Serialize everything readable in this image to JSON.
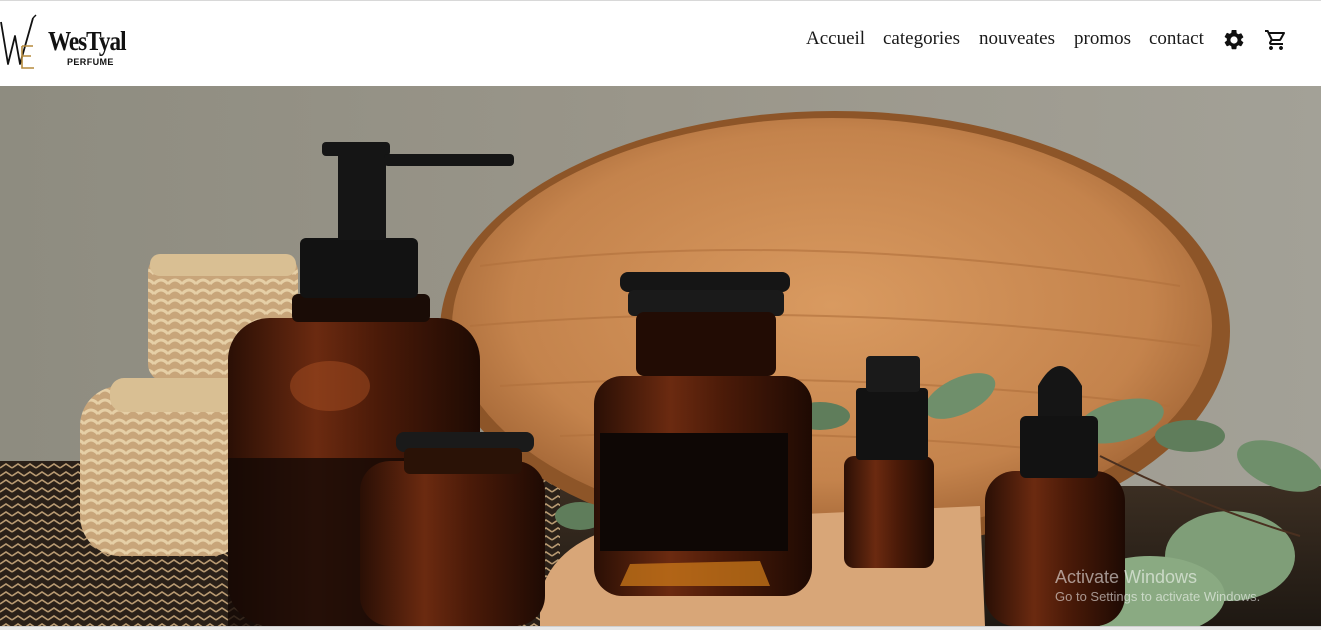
{
  "brand": {
    "name": "WesTyal",
    "tagline": "PERFUME",
    "monogram_icon": "we-monogram-logo",
    "gold": "#b58a3c"
  },
  "nav": {
    "items": [
      {
        "label": "Accueil"
      },
      {
        "label": "categories"
      },
      {
        "label": "nouveates"
      },
      {
        "label": "promos"
      },
      {
        "label": "contact"
      }
    ],
    "settings_icon": "gear-icon",
    "cart_icon": "shopping-cart-icon"
  },
  "hero": {
    "subject": "amber-glass-bottles-wooden-tray",
    "colors": {
      "wall": "#8f8f86",
      "wood": "#c98a52",
      "amber": "#4a1d0c",
      "cork": "#d8a678",
      "leaf": "#6f8f6b"
    }
  },
  "os_watermark": {
    "title": "Activate Windows",
    "subtitle": "Go to Settings to activate Windows."
  }
}
